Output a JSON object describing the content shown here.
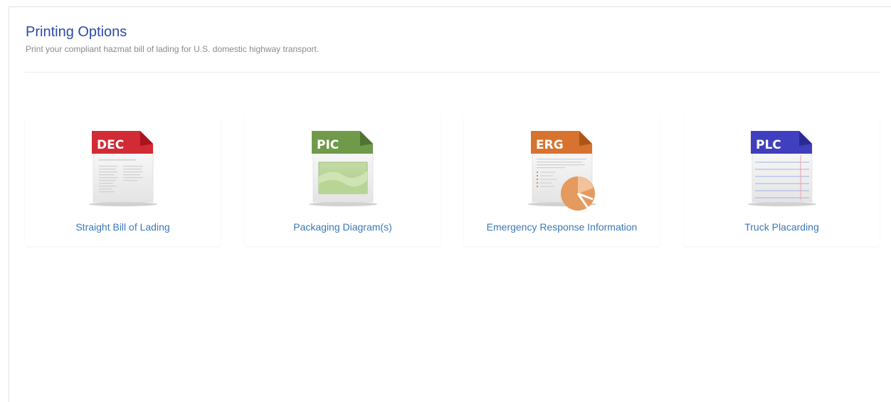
{
  "header": {
    "title": "Printing Options",
    "subtitle": "Print your compliant hazmat bill of lading for U.S. domestic highway transport."
  },
  "options": [
    {
      "code": "DEC",
      "label": "Straight Bill of Lading",
      "color": "#d22b35"
    },
    {
      "code": "PIC",
      "label": "Packaging Diagram(s)",
      "color": "#6f9a4a"
    },
    {
      "code": "ERG",
      "label": "Emergency Response Information",
      "color": "#d7732f"
    },
    {
      "code": "PLC",
      "label": "Truck Placarding",
      "color": "#3f3fbf"
    }
  ]
}
